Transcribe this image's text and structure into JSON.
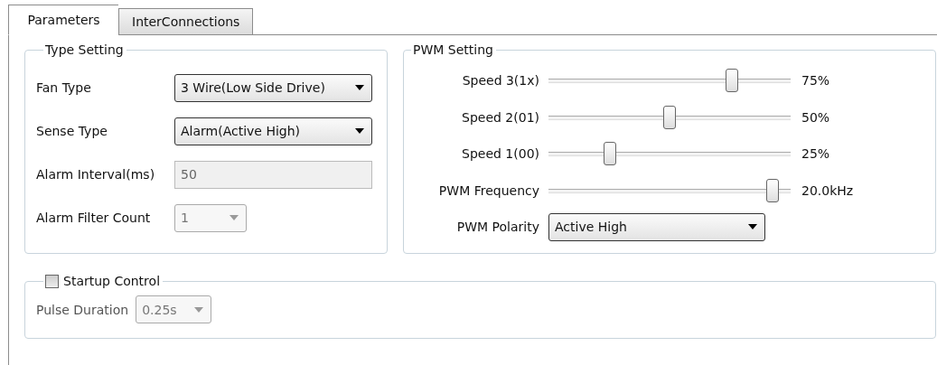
{
  "tabs": [
    {
      "label": "Parameters",
      "selected": true
    },
    {
      "label": "InterConnections",
      "selected": false
    }
  ],
  "type_setting": {
    "title": "Type Setting",
    "fields": [
      {
        "label": "Fan Type",
        "kind": "dropdown",
        "value": "3 Wire(Low Side Drive)",
        "disabled": false
      },
      {
        "label": "Sense Type",
        "kind": "dropdown",
        "value": "Alarm(Active High)",
        "disabled": false
      },
      {
        "label": "Alarm Interval(ms)",
        "kind": "text",
        "value": "50",
        "disabled": true
      },
      {
        "label": "Alarm Filter Count",
        "kind": "spin",
        "value": "1",
        "disabled": true
      }
    ]
  },
  "pwm_setting": {
    "title": "PWM Setting",
    "sliders": [
      {
        "label": "Speed 3(1x)",
        "level": 0.77,
        "reading": "75%"
      },
      {
        "label": "Speed 2(01)",
        "level": 0.5,
        "reading": "50%"
      },
      {
        "label": "Speed 1(00)",
        "level": 0.24,
        "reading": "25%"
      },
      {
        "label": "PWM Frequency",
        "level": 0.95,
        "reading": "20.0kHz"
      }
    ],
    "polarity": {
      "label": "PWM Polarity",
      "value": "Active High"
    }
  },
  "startup_control": {
    "title": "Startup Control",
    "checked": false,
    "pulse_duration": {
      "label": "Pulse Duration",
      "value": "0.25s",
      "disabled": true
    }
  }
}
